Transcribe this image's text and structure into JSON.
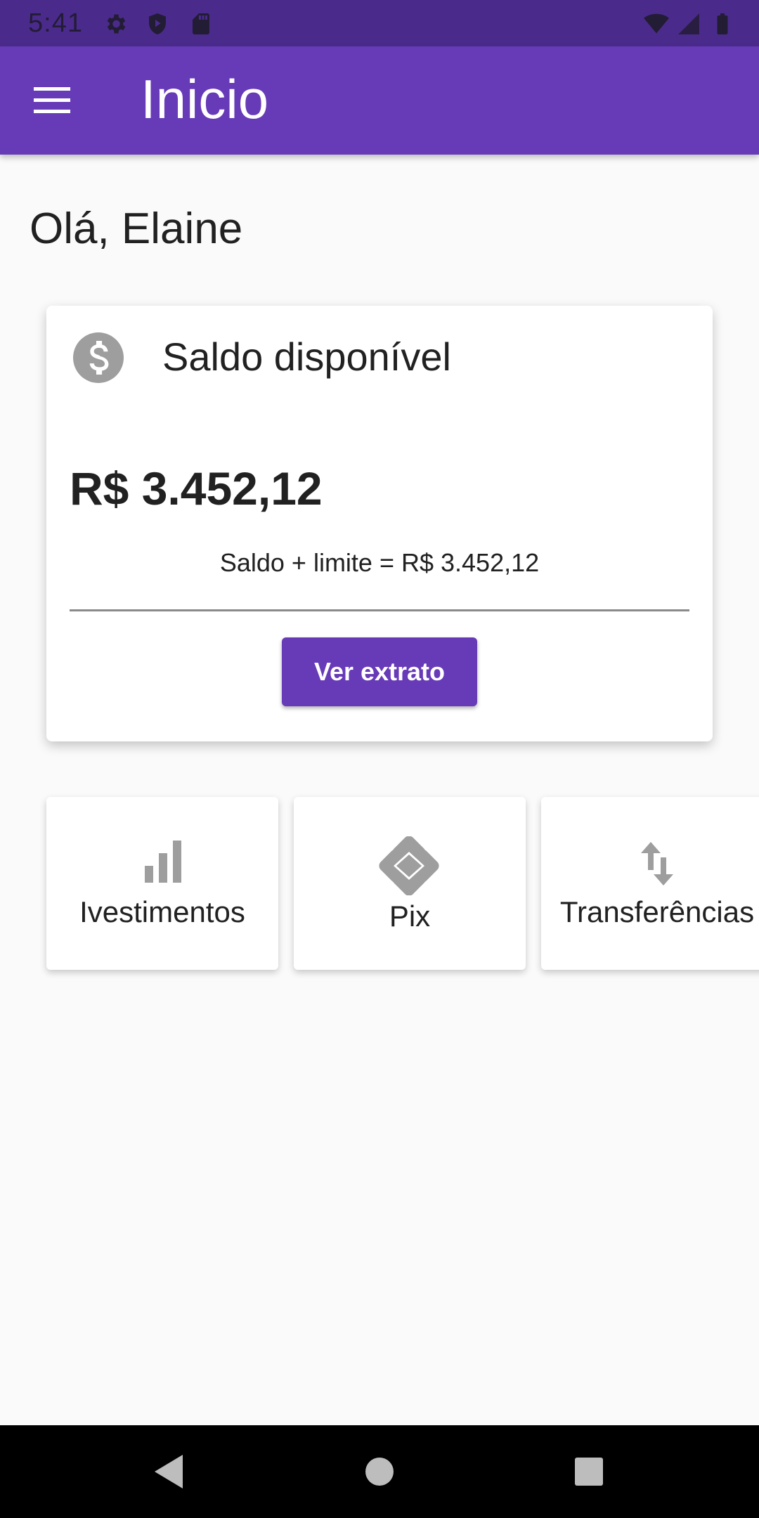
{
  "status_bar": {
    "time": "5:41",
    "left_icons": [
      "gear-icon",
      "shield-icon",
      "sd-card-icon"
    ],
    "right_icons": [
      "wifi-icon",
      "signal-icon",
      "battery-icon"
    ]
  },
  "app_bar": {
    "title": "Inicio",
    "menu_icon": "menu-icon"
  },
  "greeting": "Olá, Elaine",
  "balance_card": {
    "icon": "dollar-icon",
    "title": "Saldo disponível",
    "amount": "R$ 3.452,12",
    "balance_with_limit": "Saldo + limite = R$ 3.452,12",
    "button_label": "Ver extrato"
  },
  "shortcuts": [
    {
      "label": "Ivestimentos",
      "icon": "bar-chart-icon"
    },
    {
      "label": "Pix",
      "icon": "pix-icon"
    },
    {
      "label": "Transferências",
      "icon": "swap-vertical-icon"
    }
  ],
  "nav_bar": {
    "icons": [
      "back-icon",
      "home-icon",
      "recents-icon"
    ]
  },
  "colors": {
    "primary": "#673ab7",
    "status_bar": "#4a2b8c",
    "background": "#fafafa",
    "icon_gray": "#9e9e9e"
  }
}
